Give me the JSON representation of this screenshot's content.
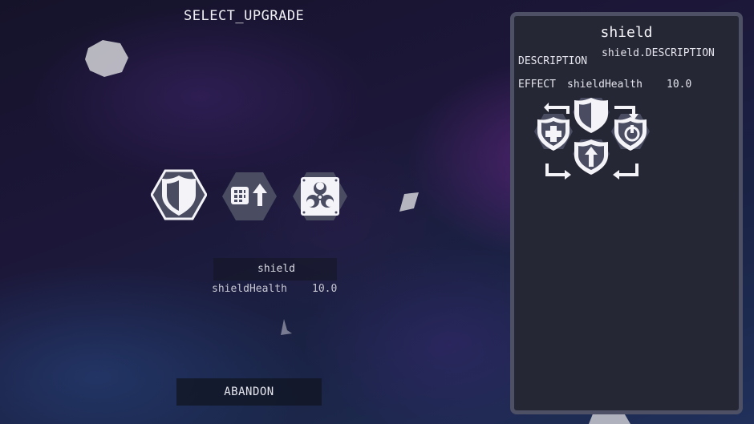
{
  "screen_title": "SELECT_UPGRADE",
  "upgrades": [
    {
      "icon": "shield-icon",
      "selected": true
    },
    {
      "icon": "module-boost-icon",
      "selected": false
    },
    {
      "icon": "biohazard-icon",
      "selected": false
    }
  ],
  "selection": {
    "name": "shield",
    "stat_name": "shieldHealth",
    "stat_value": "10.0"
  },
  "abandon_label": "ABANDON",
  "detail_panel": {
    "title": "shield",
    "description_label": "DESCRIPTION",
    "description_value": "shield.DESCRIPTION",
    "effect_label": "EFFECT",
    "effect_stat": "shieldHealth",
    "effect_value": "10.0",
    "icon": "shield-upgrade-tree-icon"
  },
  "colors": {
    "panel_bg": "#262735",
    "panel_border": "#4e5066",
    "hex_bg": "#4a4c62",
    "icon_white": "#f4f4f8"
  }
}
